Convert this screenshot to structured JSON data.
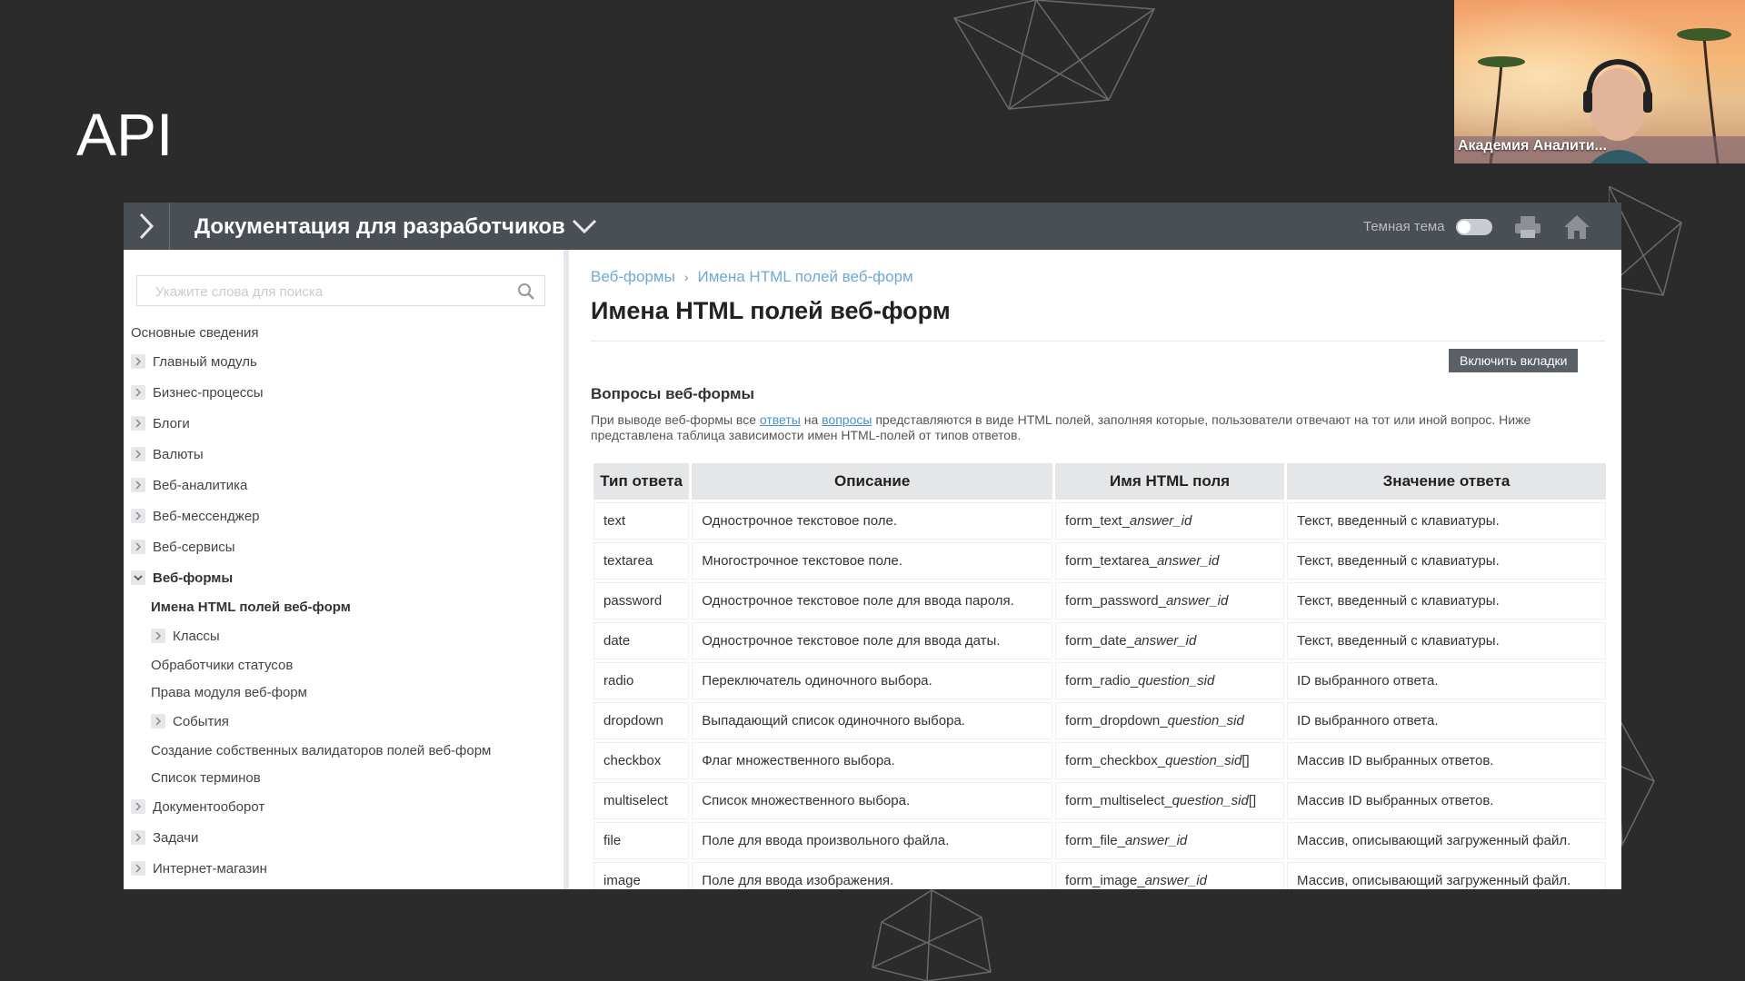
{
  "slide": {
    "title": "API"
  },
  "webcam": {
    "caption": "Академия Аналити..."
  },
  "topbar": {
    "title": "Документация для разработчиков",
    "theme_label": "Темная тема"
  },
  "search": {
    "placeholder": "Укажите слова для поиска"
  },
  "sidebar": {
    "items": [
      {
        "label": "Основные сведения",
        "expander": "none",
        "indent": 0
      },
      {
        "label": "Главный модуль",
        "expander": "collapsed",
        "indent": 0
      },
      {
        "label": "Бизнес-процессы",
        "expander": "collapsed",
        "indent": 0
      },
      {
        "label": "Блоги",
        "expander": "collapsed",
        "indent": 0
      },
      {
        "label": "Валюты",
        "expander": "collapsed",
        "indent": 0
      },
      {
        "label": "Веб-аналитика",
        "expander": "collapsed",
        "indent": 0
      },
      {
        "label": "Веб-мессенджер",
        "expander": "collapsed",
        "indent": 0
      },
      {
        "label": "Веб-сервисы",
        "expander": "collapsed",
        "indent": 0
      },
      {
        "label": "Веб-формы",
        "expander": "expanded",
        "indent": 0
      },
      {
        "label": "Имена HTML полей веб-форм",
        "expander": "none",
        "indent": 1
      },
      {
        "label": "Классы",
        "expander": "collapsed",
        "indent": 1
      },
      {
        "label": "Обработчики статусов",
        "expander": "none",
        "indent": 1
      },
      {
        "label": "Права модуля веб-форм",
        "expander": "none",
        "indent": 1
      },
      {
        "label": "События",
        "expander": "collapsed",
        "indent": 1
      },
      {
        "label": "Создание собственных валидаторов полей веб-форм",
        "expander": "none",
        "indent": 1
      },
      {
        "label": "Список терминов",
        "expander": "none",
        "indent": 1
      },
      {
        "label": "Документооборот",
        "expander": "collapsed",
        "indent": 0
      },
      {
        "label": "Задачи",
        "expander": "collapsed",
        "indent": 0
      },
      {
        "label": "Интернет-магазин",
        "expander": "collapsed",
        "indent": 0
      }
    ]
  },
  "content": {
    "breadcrumb": [
      "Веб-формы",
      "Имена HTML полей веб-форм"
    ],
    "breadcrumb_sep": "›",
    "title": "Имена HTML полей веб-форм",
    "tabs_button": "Включить вкладки",
    "section_title": "Вопросы веб-формы",
    "intro": {
      "p1": "При выводе веб-формы все ",
      "link1": "ответы",
      "p2": " на ",
      "link2": "вопросы",
      "p3": " представляются в виде HTML полей, заполняя которые, пользователи отвечают на тот или иной вопрос. Ниже представлена таблица зависимости имен HTML-полей от типов ответов."
    },
    "table": {
      "headers": [
        "Тип ответа",
        "Описание",
        "Имя HTML поля",
        "Значение ответа"
      ],
      "rows": [
        {
          "type": "text",
          "desc": "Однострочное текстовое поле.",
          "field_prefix": "form_text_",
          "field_var": "answer_id",
          "field_suffix": "",
          "value": "Текст, введенный с клавиатуры."
        },
        {
          "type": "textarea",
          "desc": "Многострочное текстовое поле.",
          "field_prefix": "form_textarea_",
          "field_var": "answer_id",
          "field_suffix": "",
          "value": "Текст, введенный с клавиатуры."
        },
        {
          "type": "password",
          "desc": "Однострочное текстовое поле для ввода пароля.",
          "field_prefix": "form_password_",
          "field_var": "answer_id",
          "field_suffix": "",
          "value": "Текст, введенный с клавиатуры."
        },
        {
          "type": "date",
          "desc": "Однострочное текстовое поле для ввода даты.",
          "field_prefix": "form_date_",
          "field_var": "answer_id",
          "field_suffix": "",
          "value": "Текст, введенный с клавиатуры."
        },
        {
          "type": "radio",
          "desc": "Переключатель одиночного выбора.",
          "field_prefix": "form_radio_",
          "field_var": "question_sid",
          "field_suffix": "",
          "value": "ID выбранного ответа."
        },
        {
          "type": "dropdown",
          "desc": "Выпадающий список одиночного выбора.",
          "field_prefix": "form_dropdown_",
          "field_var": "question_sid",
          "field_suffix": "",
          "value": "ID выбранного ответа."
        },
        {
          "type": "checkbox",
          "desc": "Флаг множественного выбора.",
          "field_prefix": "form_checkbox_",
          "field_var": "question_sid",
          "field_suffix": "[]",
          "value": "Массив ID выбранных ответов."
        },
        {
          "type": "multiselect",
          "desc": "Список множественного выбора.",
          "field_prefix": "form_multiselect_",
          "field_var": "question_sid",
          "field_suffix": "[]",
          "value": "Массив ID выбранных ответов."
        },
        {
          "type": "file",
          "desc": "Поле для ввода произвольного файла.",
          "field_prefix": "form_file_",
          "field_var": "answer_id",
          "field_suffix": "",
          "value": "Массив, описывающий загруженный файл."
        },
        {
          "type": "image",
          "desc": "Поле для ввода изображения.",
          "field_prefix": "form_image_",
          "field_var": "answer_id",
          "field_suffix": "",
          "value": "Массив, описывающий загруженный файл."
        }
      ]
    }
  },
  "colors": {
    "background": "#2b2b2b",
    "topbar": "#4a4f55",
    "link": "#4a90c6",
    "breadcrumb": "#6fa9cf",
    "table_header": "#e5e6e8"
  }
}
